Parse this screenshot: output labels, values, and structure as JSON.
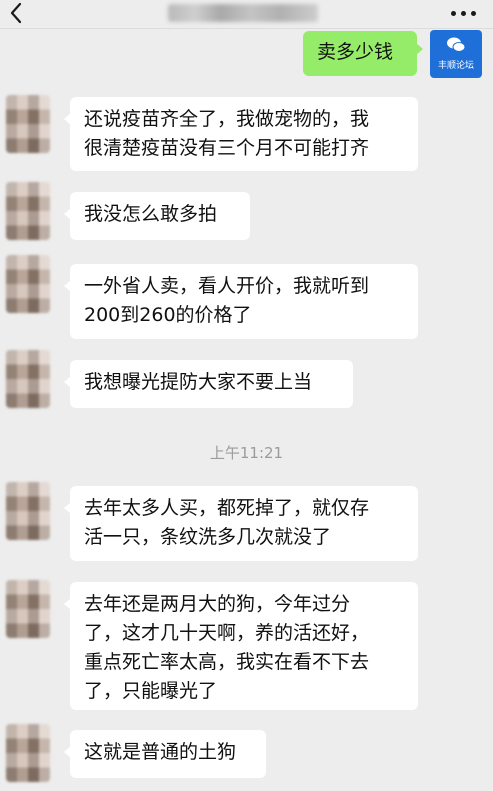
{
  "header": {
    "back_icon": "chevron-left-icon",
    "more_icon": "more-dots-icon"
  },
  "self": {
    "avatar_caption": "丰顺论坛",
    "avatar_icon": "wechat-logo-icon",
    "bubble_color": "#95ec69"
  },
  "messages": [
    {
      "from": "self",
      "text": "卖多少钱"
    },
    {
      "from": "other",
      "text": "还说疫苗齐全了，我做宠物的，我\n很清楚疫苗没有三个月不可能打齐"
    },
    {
      "from": "other",
      "text": "我没怎么敢多拍"
    },
    {
      "from": "other",
      "text": "一外省人卖，看人开价，我就听到\n200到260的价格了"
    },
    {
      "from": "other",
      "text": "我想曝光提防大家不要上当"
    },
    {
      "from": "other",
      "text": "去年太多人买，都死掉了，就仅存\n活一只，条纹洗多几次就没了"
    },
    {
      "from": "other",
      "text": "去年还是两月大的狗，今年过分\n了，这才几十天啊，养的活还好，\n重点死亡率太高，我实在看不下去\n了，只能曝光了"
    },
    {
      "from": "other",
      "text": "这就是普通的土狗"
    }
  ],
  "timestamp": "上午11:21",
  "colors": {
    "background": "#ededed",
    "incoming_bubble": "#ffffff",
    "timestamp": "#9b9b9b"
  }
}
